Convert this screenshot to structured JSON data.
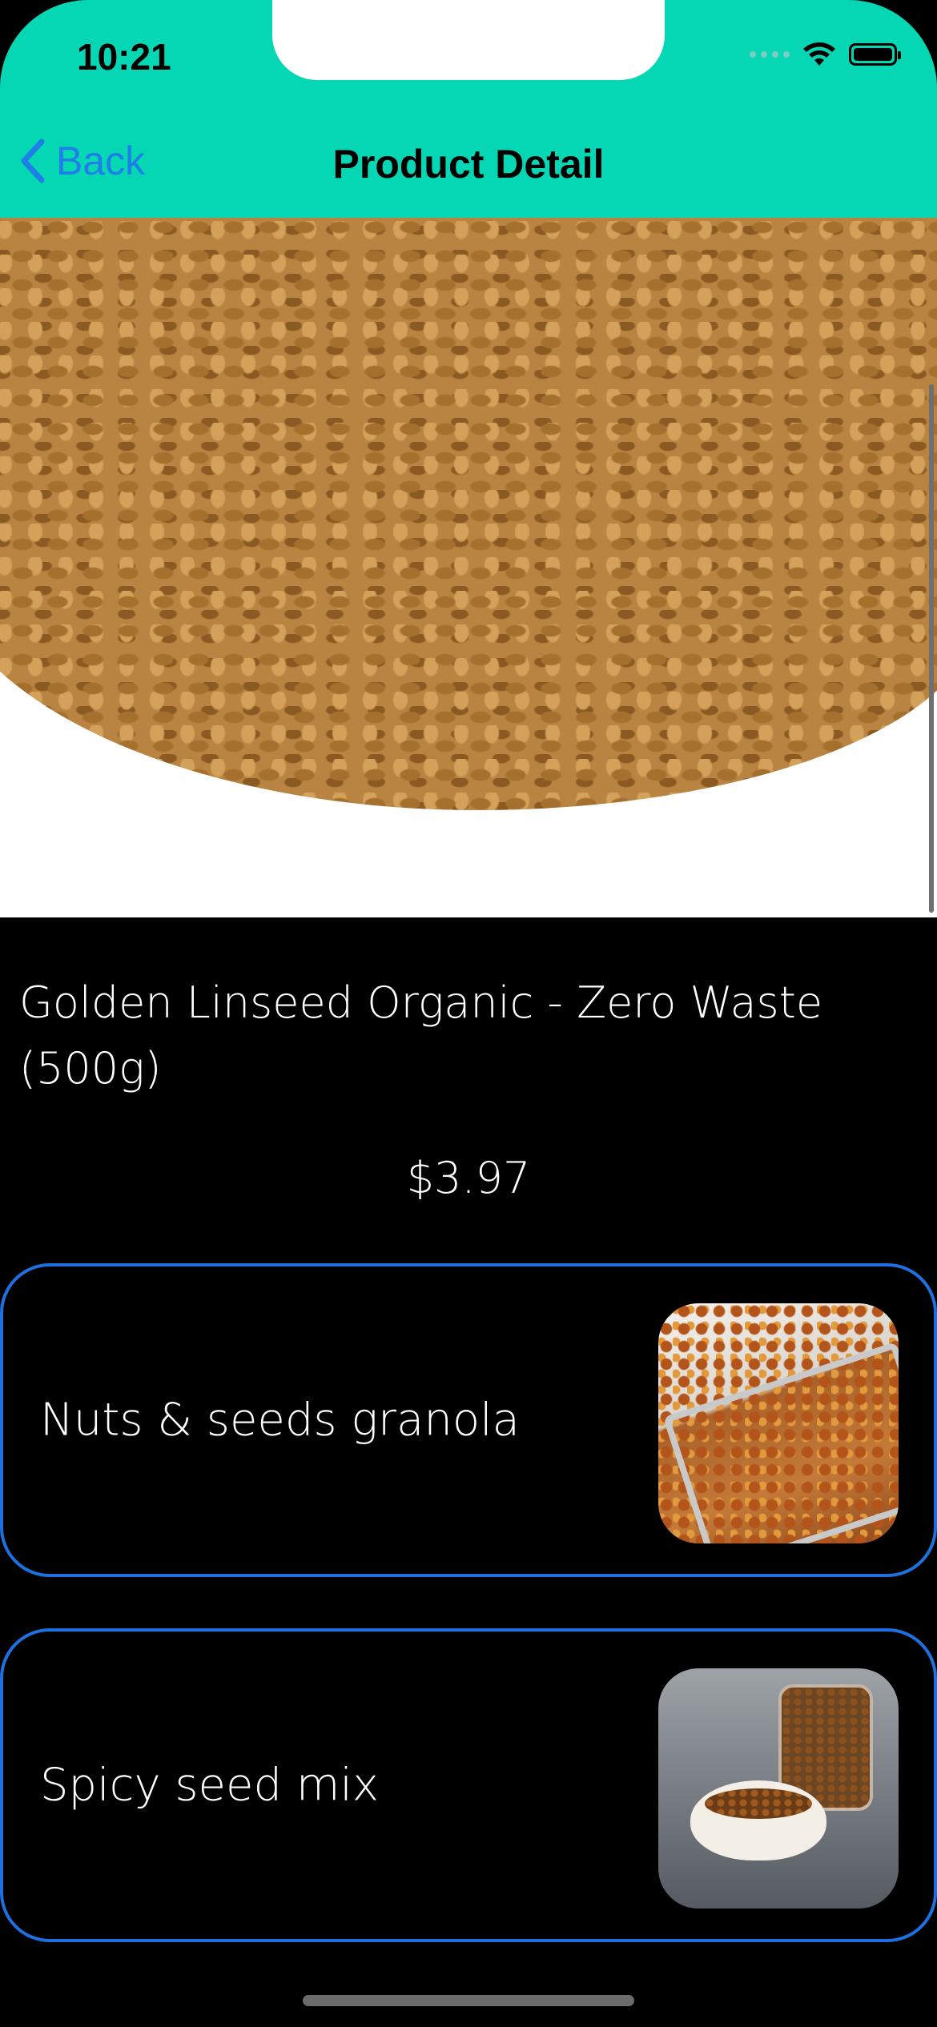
{
  "status_bar": {
    "time": "10:21"
  },
  "nav": {
    "back_label": "Back",
    "title": "Product Detail",
    "accent_color": "#05d6b3",
    "link_color": "#1f7fe8"
  },
  "product": {
    "image_icon": "product-photo",
    "title": "Golden Linseed Organic - Zero Waste (500g)",
    "price": "$3.97"
  },
  "suggestions": [
    {
      "label": "Nuts & seeds granola",
      "image_icon": "granola-photo"
    },
    {
      "label": "Spicy seed mix",
      "image_icon": "seed-mix-photo"
    }
  ],
  "colors": {
    "card_border": "#1e6fe0",
    "background": "#000000",
    "text": "#ffffff"
  }
}
